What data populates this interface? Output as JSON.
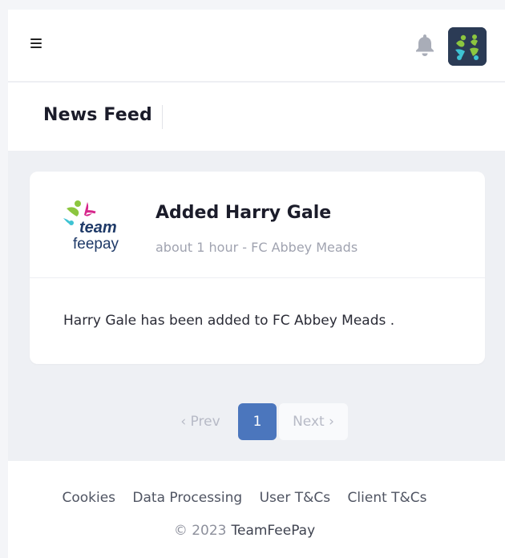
{
  "header": {
    "menu_icon": "hamburger-menu-icon",
    "notification_icon": "bell-icon",
    "avatar_icon": "teamfeepay-logo"
  },
  "page": {
    "title": "News Feed"
  },
  "feed": {
    "items": [
      {
        "logo": {
          "name": "teamfeepay-logo",
          "line1": "team",
          "line2": "feepay"
        },
        "title": "Added Harry Gale",
        "meta": "about 1 hour - FC Abbey Meads",
        "body": "Harry Gale has been added to FC Abbey Meads ."
      }
    ]
  },
  "pagination": {
    "prev_label": "‹ Prev",
    "current_page": "1",
    "next_label": "Next ›"
  },
  "footer": {
    "links": [
      "Cookies",
      "Data Processing",
      "User T&Cs",
      "Client T&Cs"
    ],
    "copyright": "© 2023",
    "brand": "TeamFeePay"
  },
  "colors": {
    "accent": "#4b76bd",
    "logo_pink": "#d6268b",
    "logo_green": "#8cc63f",
    "logo_cyan": "#3ec3d3",
    "logo_navy": "#1f3a68"
  }
}
